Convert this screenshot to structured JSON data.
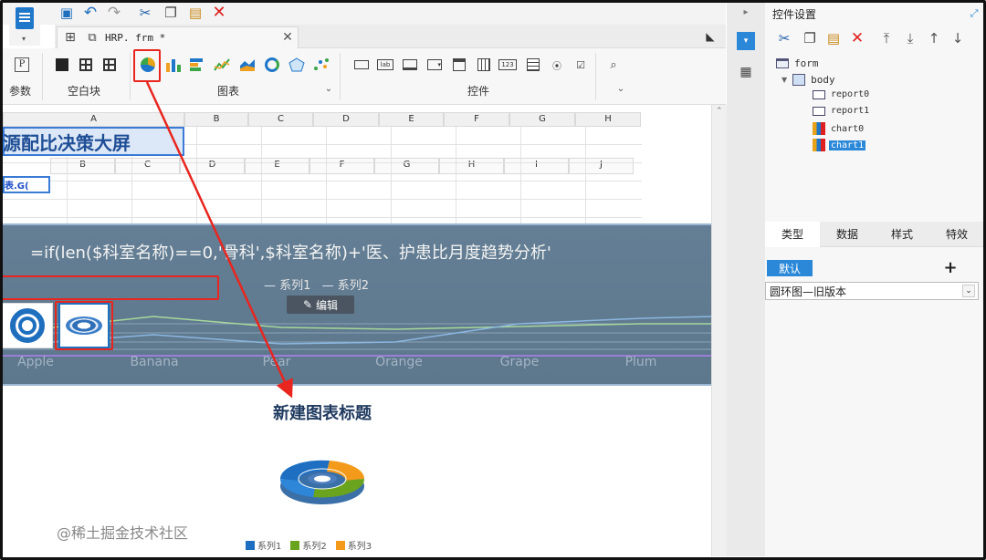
{
  "toolbar": {
    "file_tab": "HRP. frm *"
  },
  "ribbon": {
    "group_params": "参数",
    "group_blank": "空白块",
    "group_chart": "图表",
    "group_controls": "控件",
    "control_icons": [
      "text-box",
      "label",
      "button-box",
      "combo",
      "calendar",
      "datagrid",
      "number",
      "list",
      "radio-list",
      "check-list",
      "search"
    ]
  },
  "sheet": {
    "cols_top": [
      "A",
      "B",
      "C",
      "D",
      "E",
      "F",
      "G",
      "H"
    ],
    "cols_inner": [
      "B",
      "C",
      "D",
      "E",
      "F",
      "G",
      "H",
      "I",
      "J"
    ],
    "title_cell": "源配比决策大屏",
    "formula_cell": "表.G("
  },
  "chart_upper": {
    "formula_title": "=if(len($科室名称)==0,'骨科',$科室名称)+'医、护患比月度趋势分析'",
    "edit_label": "编辑",
    "legend": [
      "系列1",
      "系列2"
    ],
    "categories": [
      "Apple",
      "Banana",
      "Pear",
      "Orange",
      "Grape",
      "Plum"
    ]
  },
  "chart_lower": {
    "title": "新建图表标题",
    "legend": [
      "系列1",
      "系列2",
      "系列3"
    ],
    "colors": [
      "#1e6fc1",
      "#6aa41f",
      "#f39a1a"
    ]
  },
  "panel": {
    "title": "控件设置",
    "tree": {
      "form": "form",
      "body": "body",
      "items": [
        "report0",
        "report1",
        "chart0",
        "chart1"
      ]
    },
    "tabs": [
      "类型",
      "数据",
      "样式",
      "特效"
    ],
    "default_label": "默认",
    "select_value": "圆环图—旧版本"
  },
  "watermark": "@稀土掘金技术社区"
}
